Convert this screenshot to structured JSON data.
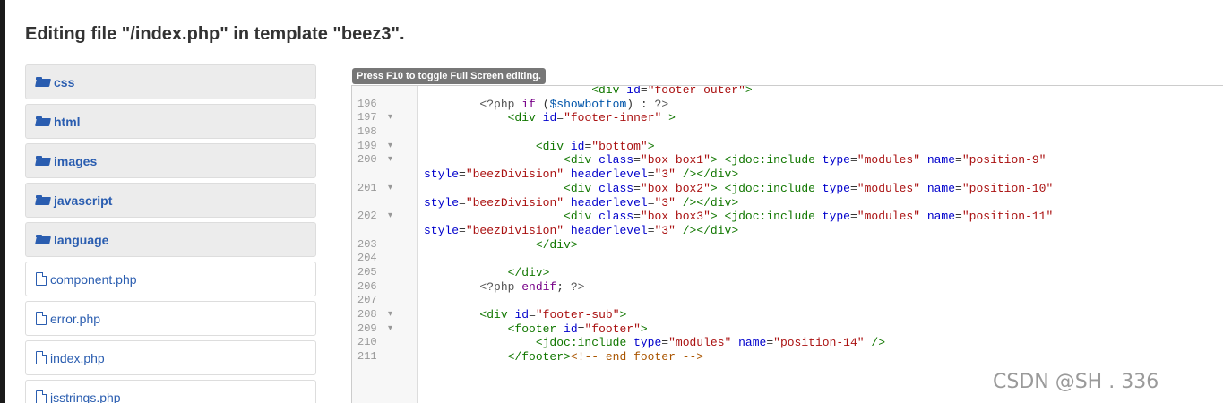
{
  "page": {
    "title": "Editing file \"/index.php\" in template \"beez3\"."
  },
  "tree": {
    "items": [
      {
        "type": "folder",
        "label": "css"
      },
      {
        "type": "folder",
        "label": "html"
      },
      {
        "type": "folder",
        "label": "images"
      },
      {
        "type": "folder",
        "label": "javascript"
      },
      {
        "type": "folder",
        "label": "language"
      },
      {
        "type": "file",
        "label": "component.php"
      },
      {
        "type": "file",
        "label": "error.php"
      },
      {
        "type": "file",
        "label": "index.php"
      },
      {
        "type": "file",
        "label": "jsstrings.php"
      }
    ]
  },
  "editor": {
    "hint": "Press F10 to toggle Full Screen editing.",
    "lines": [
      {
        "n": "",
        "fold": "",
        "code": "                        <div id=\"footer-outer\">"
      },
      {
        "n": "196",
        "fold": "",
        "code": "        <?php if ($showbottom) : ?>"
      },
      {
        "n": "197",
        "fold": "▾",
        "code": "            <div id=\"footer-inner\" >"
      },
      {
        "n": "198",
        "fold": "",
        "code": ""
      },
      {
        "n": "199",
        "fold": "▾",
        "code": "                <div id=\"bottom\">"
      },
      {
        "n": "200",
        "fold": "▾",
        "code": "                    <div class=\"box box1\"> <jdoc:include type=\"modules\" name=\"position-9\""
      },
      {
        "n": "",
        "fold": "",
        "code": "style=\"beezDivision\" headerlevel=\"3\" /></div>"
      },
      {
        "n": "201",
        "fold": "▾",
        "code": "                    <div class=\"box box2\"> <jdoc:include type=\"modules\" name=\"position-10\""
      },
      {
        "n": "",
        "fold": "",
        "code": "style=\"beezDivision\" headerlevel=\"3\" /></div>"
      },
      {
        "n": "202",
        "fold": "▾",
        "code": "                    <div class=\"box box3\"> <jdoc:include type=\"modules\" name=\"position-11\""
      },
      {
        "n": "",
        "fold": "",
        "code": "style=\"beezDivision\" headerlevel=\"3\" /></div>"
      },
      {
        "n": "203",
        "fold": "",
        "code": "                </div>"
      },
      {
        "n": "204",
        "fold": "",
        "code": ""
      },
      {
        "n": "205",
        "fold": "",
        "code": "            </div>"
      },
      {
        "n": "206",
        "fold": "",
        "code": "        <?php endif; ?>"
      },
      {
        "n": "207",
        "fold": "",
        "code": ""
      },
      {
        "n": "208",
        "fold": "▾",
        "code": "        <div id=\"footer-sub\">"
      },
      {
        "n": "209",
        "fold": "▾",
        "code": "            <footer id=\"footer\">"
      },
      {
        "n": "210",
        "fold": "",
        "code": "                <jdoc:include type=\"modules\" name=\"position-14\" />"
      },
      {
        "n": "211",
        "fold": "",
        "code": "            </footer><!-- end footer -->"
      }
    ]
  },
  "watermark": "CSDN @SH    . 336"
}
